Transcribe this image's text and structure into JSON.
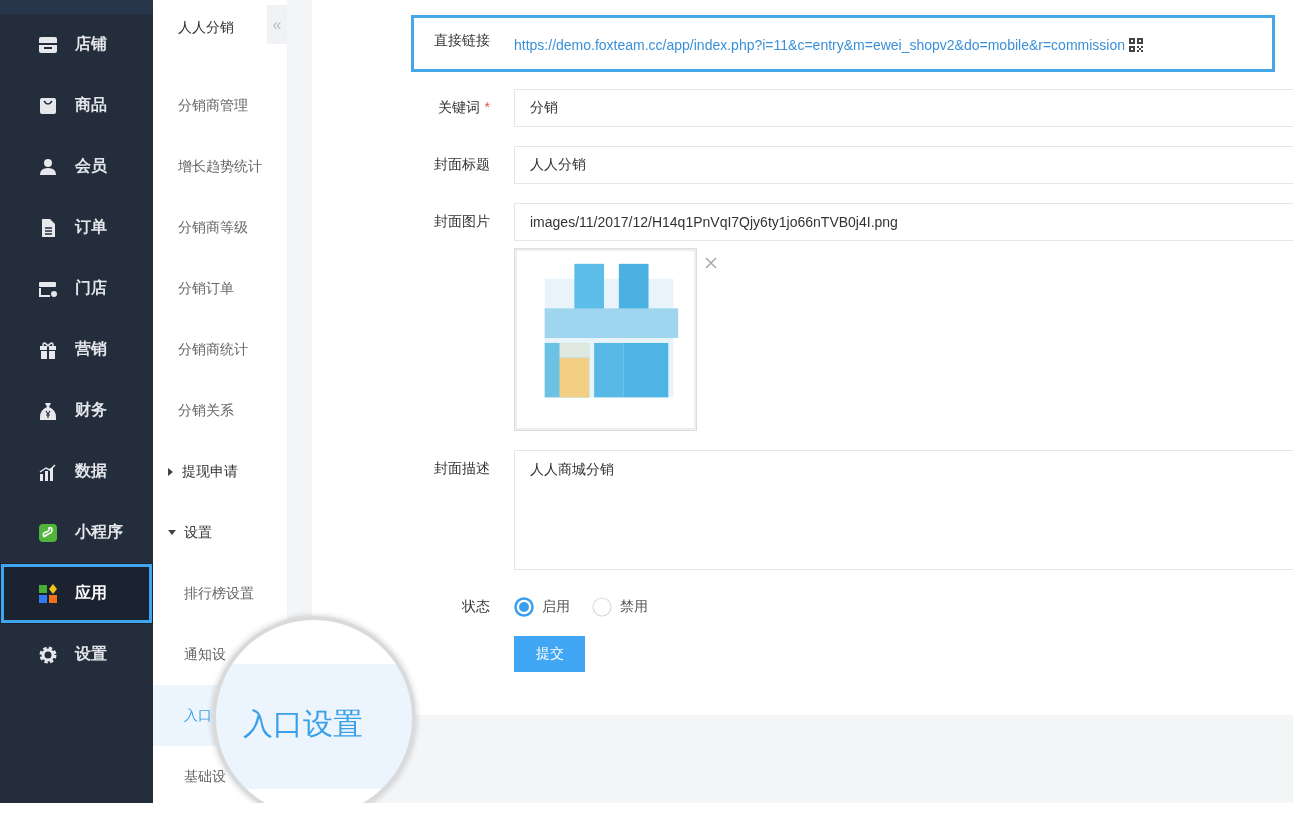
{
  "main_nav": {
    "items": [
      {
        "label": "店铺",
        "selected": false,
        "highlighted": false
      },
      {
        "label": "商品",
        "selected": false,
        "highlighted": false
      },
      {
        "label": "会员",
        "selected": false,
        "highlighted": false
      },
      {
        "label": "订单",
        "selected": false,
        "highlighted": false
      },
      {
        "label": "门店",
        "selected": false,
        "highlighted": false
      },
      {
        "label": "营销",
        "selected": false,
        "highlighted": false
      },
      {
        "label": "财务",
        "selected": false,
        "highlighted": false
      },
      {
        "label": "数据",
        "selected": false,
        "highlighted": false
      },
      {
        "label": "小程序",
        "selected": false,
        "highlighted": false
      },
      {
        "label": "应用",
        "selected": true,
        "highlighted": true
      },
      {
        "label": "设置",
        "selected": false,
        "highlighted": false
      }
    ]
  },
  "sub_nav": {
    "title": "人人分销",
    "collapse": "«",
    "items": [
      {
        "label": "分销商管理",
        "selected": false
      },
      {
        "label": "增长趋势统计",
        "selected": false
      },
      {
        "label": "分销商等级",
        "selected": false
      },
      {
        "label": "分销订单",
        "selected": false
      },
      {
        "label": "分销商统计",
        "selected": false
      },
      {
        "label": "分销关系",
        "selected": false
      },
      {
        "label": "提现申请",
        "selected": false,
        "expanded": false
      },
      {
        "label": "设置",
        "selected": false,
        "expanded": true,
        "children": [
          {
            "label": "排行榜设置",
            "selected": false
          },
          {
            "label": "通知设",
            "selected": false
          },
          {
            "label": "入口",
            "selected": true
          },
          {
            "label": "基础设",
            "selected": false
          }
        ]
      }
    ]
  },
  "magnifier": {
    "text": "入口设置"
  },
  "form": {
    "rows": [
      {
        "kind": "link",
        "label": "直接链接",
        "value": "https://demo.foxteam.cc/app/index.php?i=11&c=entry&m=ewei_shopv2&do=mobile&r=commission",
        "highlighted": true
      },
      {
        "kind": "input",
        "label": "关键词",
        "required_mark": "*",
        "value": "分销",
        "highlighted": false
      },
      {
        "kind": "input",
        "label": "封面标题",
        "value": "人人分销",
        "highlighted": false
      },
      {
        "label": "封面图片",
        "value": "images/11/2017/12/H14q1PnVqI7Qjy6ty1jo66nTVB0j4I.png",
        "highlighted": false
      },
      {
        "kind": "textarea",
        "label": "封面描述",
        "value": "人人商城分销",
        "highlighted": false
      },
      {
        "kind": "radio",
        "label": "状态",
        "highlighted": false,
        "options": [
          {
            "label": "启用",
            "selected": true
          },
          {
            "label": "禁用",
            "selected": false
          }
        ]
      }
    ],
    "submit": "提交"
  }
}
